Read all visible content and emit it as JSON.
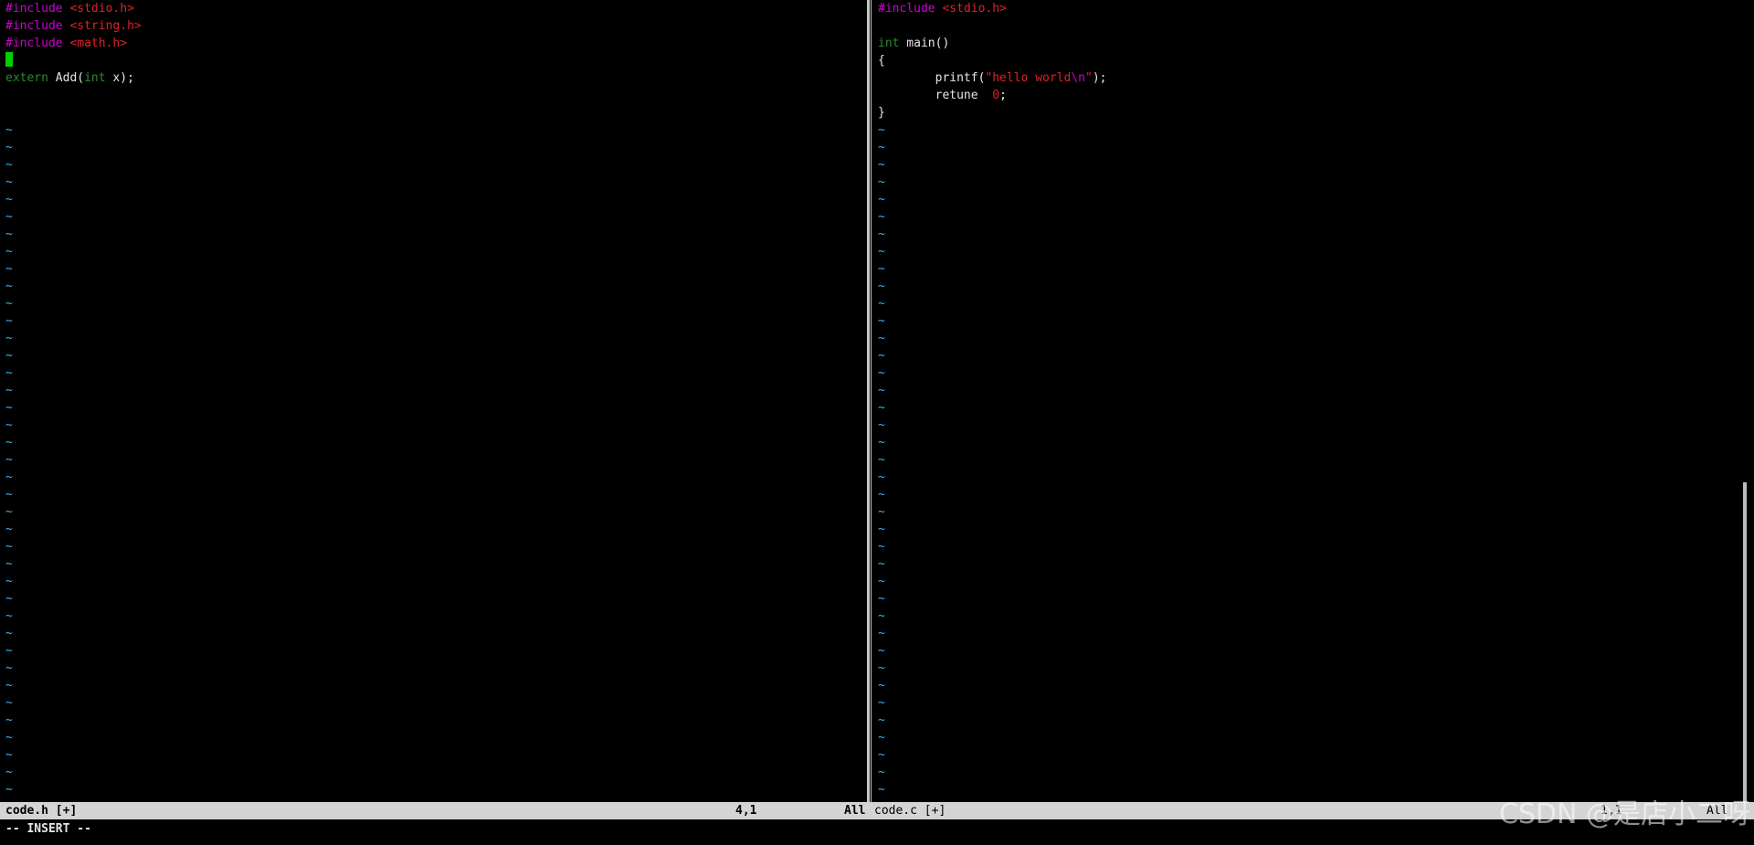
{
  "left_buffer": {
    "lines": [
      [
        {
          "t": "#include ",
          "c": "pre"
        },
        {
          "t": "<stdio.h>",
          "c": "str"
        }
      ],
      [
        {
          "t": "#include ",
          "c": "pre"
        },
        {
          "t": "<string.h>",
          "c": "str"
        }
      ],
      [
        {
          "t": "#include ",
          "c": "pre"
        },
        {
          "t": "<math.h>",
          "c": "str"
        }
      ],
      [
        {
          "t": "",
          "c": "cursor"
        }
      ],
      [
        {
          "t": "extern",
          "c": "type"
        },
        {
          "t": " Add(",
          "c": "plain"
        },
        {
          "t": "int",
          "c": "type"
        },
        {
          "t": " x);",
          "c": "plain"
        }
      ],
      [],
      []
    ],
    "tilde": "~"
  },
  "right_buffer": {
    "lines": [
      [
        {
          "t": "#include ",
          "c": "pre"
        },
        {
          "t": "<stdio.h>",
          "c": "str"
        }
      ],
      [],
      [
        {
          "t": "int",
          "c": "type"
        },
        {
          "t": " main()",
          "c": "plain"
        }
      ],
      [
        {
          "t": "{",
          "c": "plain"
        }
      ],
      [
        {
          "t": "        printf(",
          "c": "plain"
        },
        {
          "t": "\"hello world",
          "c": "str"
        },
        {
          "t": "\\n",
          "c": "pre"
        },
        {
          "t": "\"",
          "c": "str"
        },
        {
          "t": ");",
          "c": "plain"
        }
      ],
      [
        {
          "t": "        retune  ",
          "c": "plain"
        },
        {
          "t": "0",
          "c": "num"
        },
        {
          "t": ";",
          "c": "plain"
        }
      ],
      [
        {
          "t": "}",
          "c": "plain"
        }
      ]
    ],
    "tilde": "~"
  },
  "status": {
    "left_file": "code.h [+]",
    "left_pos": "4,1",
    "left_scroll": "All",
    "right_file": "code.c [+]",
    "right_pos": "1,1",
    "right_scroll": "All"
  },
  "mode_line": "-- INSERT --",
  "watermark": "CSDN @是店小二呀",
  "colors": {
    "background": "#000000",
    "preprocessor": "#d000d0",
    "string": "#e0202a",
    "type": "#2c8a2c",
    "tilde": "#3ab4f2",
    "cursor": "#00d000",
    "statusbar": "#d4d4d4"
  }
}
